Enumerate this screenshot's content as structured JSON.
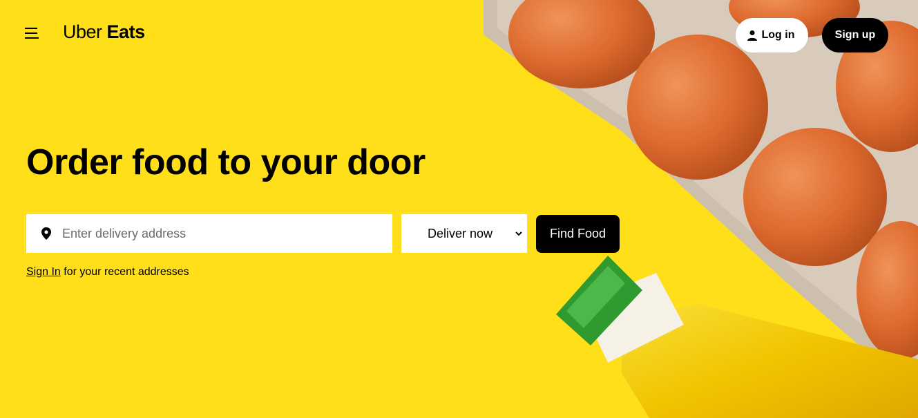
{
  "header": {
    "menu_icon": "hamburger-menu-icon",
    "logo": {
      "part1": "Uber",
      "part2": "Eats"
    },
    "login_label": "Log in",
    "login_icon": "person-icon",
    "signup_label": "Sign up"
  },
  "hero": {
    "headline": "Order food to your door",
    "address": {
      "placeholder": "Enter delivery address",
      "value": "",
      "icon": "location-pin-icon"
    },
    "deliver_time": {
      "selected": "Deliver now",
      "icon": "chevron-down-icon"
    },
    "find_button": "Find Food",
    "signin": {
      "link": "Sign In",
      "text": " for your recent addresses"
    }
  },
  "colors": {
    "brand_yellow": "#ffde1a",
    "black": "#000000",
    "white": "#ffffff"
  }
}
